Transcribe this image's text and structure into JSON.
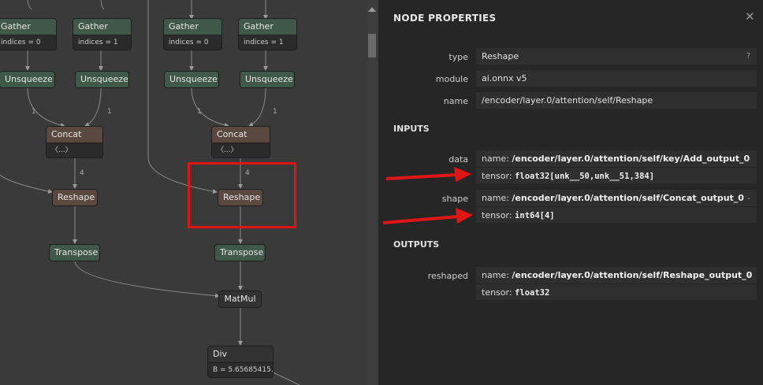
{
  "graph": {
    "nodes": {
      "gather_a": {
        "label": "Gather",
        "attr": "indices = 0"
      },
      "gather_b": {
        "label": "Gather",
        "attr": "indices = 1"
      },
      "gather_c": {
        "label": "Gather",
        "attr": "indices = 0"
      },
      "gather_d": {
        "label": "Gather",
        "attr": "indices = 1"
      },
      "unsqueeze_a": {
        "label": "Unsqueeze"
      },
      "unsqueeze_b": {
        "label": "Unsqueeze"
      },
      "unsqueeze_c": {
        "label": "Unsqueeze"
      },
      "unsqueeze_d": {
        "label": "Unsqueeze"
      },
      "concat_a": {
        "label": "Concat",
        "attr": "〈...〉"
      },
      "concat_b": {
        "label": "Concat",
        "attr": "〈...〉"
      },
      "reshape_a": {
        "label": "Reshape"
      },
      "reshape_b": {
        "label": "Reshape"
      },
      "transpose_a": {
        "label": "Transpose"
      },
      "transpose_b": {
        "label": "Transpose"
      },
      "matmul": {
        "label": "MatMul"
      },
      "div": {
        "label": "Div",
        "attr": "B = 5.65685415..."
      }
    },
    "edge_labels": {
      "l1": "1",
      "l2": "1",
      "l3": "1",
      "l4": "1",
      "l5": "4",
      "l6": "4"
    }
  },
  "panel": {
    "title": "NODE PROPERTIES",
    "close_glyph": "✕",
    "properties": {
      "type": {
        "label": "type",
        "value": "Reshape",
        "help": "?"
      },
      "module": {
        "label": "module",
        "value": "ai.onnx v5"
      },
      "name": {
        "label": "name",
        "value": "/encoder/layer.0/attention/self/Reshape"
      }
    },
    "inputs_title": "INPUTS",
    "inputs": [
      {
        "label": "data",
        "name_prefix": "name: ",
        "name": "/encoder/layer.0/attention/self/key/Add_output_0",
        "tensor_prefix": "tensor: ",
        "tensor": "float32[unk__50,unk__51,384]",
        "toggle": "-"
      },
      {
        "label": "shape",
        "name_prefix": "name: ",
        "name": "/encoder/layer.0/attention/self/Concat_output_0",
        "tensor_prefix": "tensor: ",
        "tensor": "int64[4]",
        "toggle": "-"
      }
    ],
    "outputs_title": "OUTPUTS",
    "outputs": [
      {
        "label": "reshaped",
        "name_prefix": "name: ",
        "name": "/encoder/layer.0/attention/self/Reshape_output_0",
        "tensor_prefix": "tensor: ",
        "tensor": "float32",
        "toggle": "-"
      }
    ]
  },
  "colors": {
    "annotation_red": "#e01515",
    "node_green": "#3f5849",
    "node_brown": "#5b4840"
  }
}
